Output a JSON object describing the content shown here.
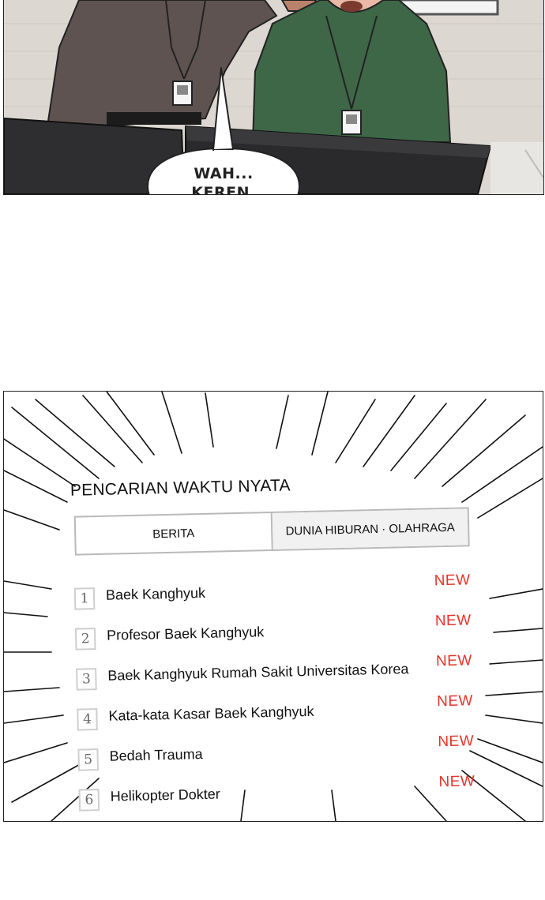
{
  "panel1": {
    "speech": {
      "lines": [
        "WAH...",
        "KEREN."
      ]
    }
  },
  "panel2": {
    "title": "PENCARIAN WAKTU NYATA",
    "tabs": [
      {
        "label": "BERITA",
        "selected": true
      },
      {
        "label": "DUNIA HIBURAN · OLAHRAGA",
        "selected": false
      }
    ],
    "new_label": "NEW",
    "new_color": "#e5332a",
    "ranking": [
      {
        "rank": "1",
        "term": "Baek Kanghyuk"
      },
      {
        "rank": "2",
        "term": "Profesor Baek Kanghyuk"
      },
      {
        "rank": "3",
        "term": "Baek Kanghyuk Rumah Sakit Universitas Korea"
      },
      {
        "rank": "4",
        "term": "Kata-kata Kasar Baek Kanghyuk"
      },
      {
        "rank": "5",
        "term": "Bedah Trauma"
      },
      {
        "rank": "6",
        "term": "Helikopter Dokter"
      }
    ]
  }
}
